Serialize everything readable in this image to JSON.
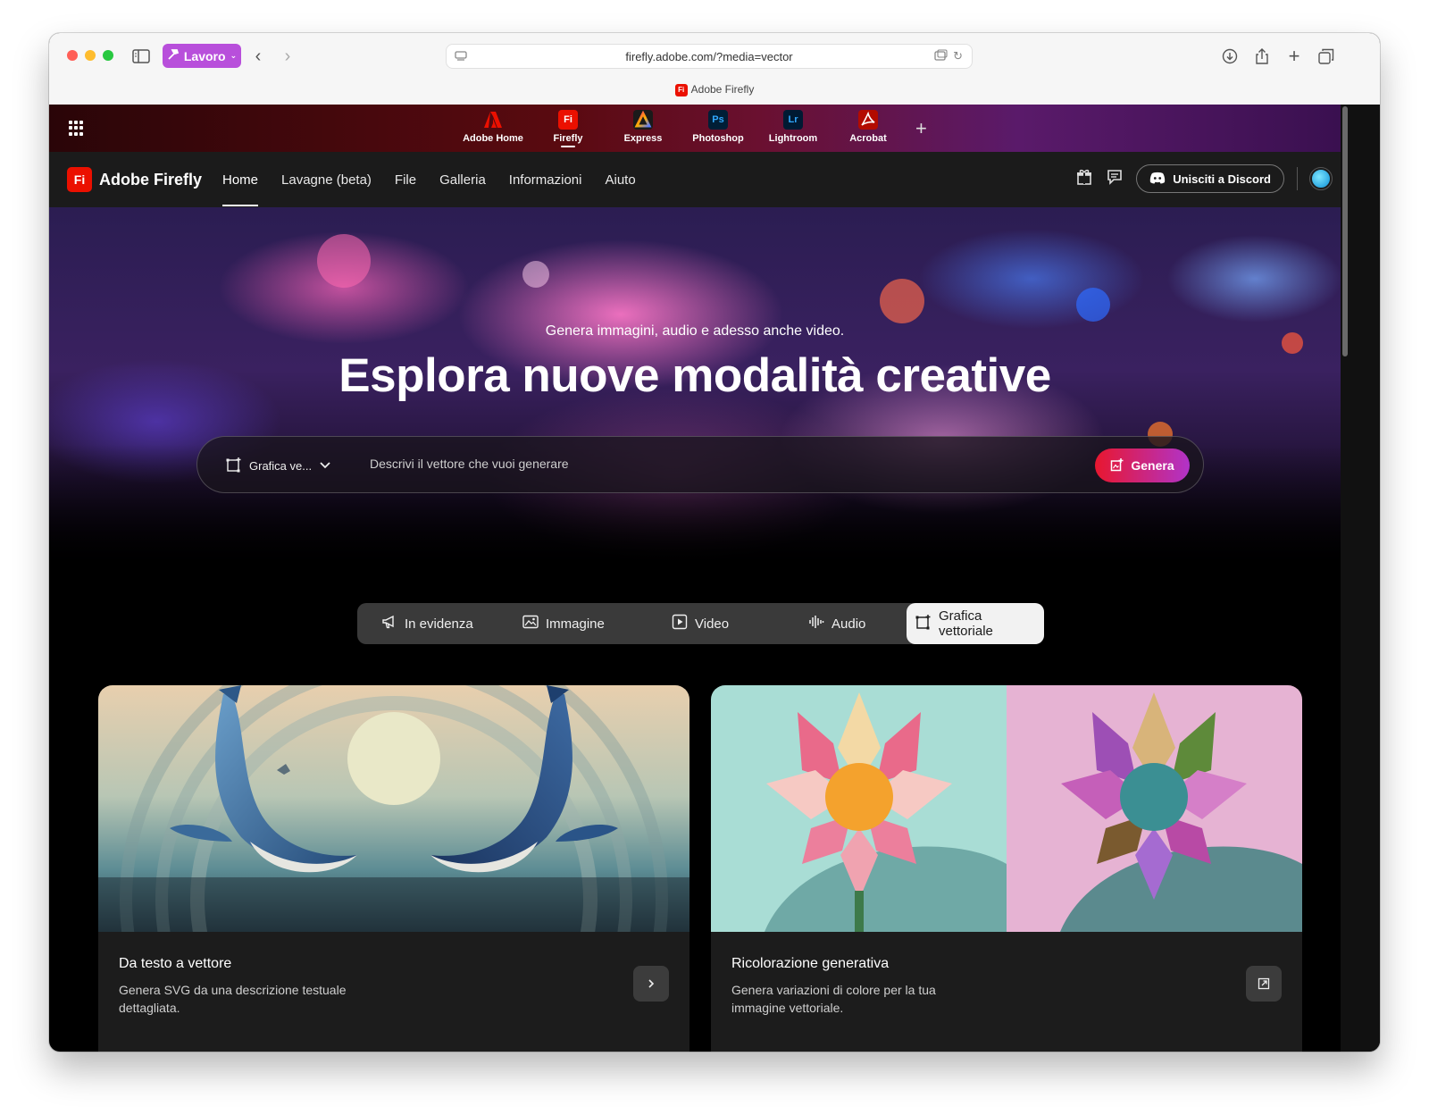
{
  "browser": {
    "profile_label": "Lavoro",
    "url": "firefly.adobe.com/?media=vector",
    "tab_title": "Adobe Firefly",
    "tab_favicon": "Fi"
  },
  "app_switcher": {
    "apps": [
      {
        "label": "Adobe Home",
        "icon_text": "",
        "color": "#eb1000"
      },
      {
        "label": "Firefly",
        "icon_text": "Fi",
        "color": "#eb1000"
      },
      {
        "label": "Express",
        "icon_text": "A",
        "color": "#1a1a1a"
      },
      {
        "label": "Photoshop",
        "icon_text": "Ps",
        "color": "#001e36"
      },
      {
        "label": "Lightroom",
        "icon_text": "Lr",
        "color": "#001a33"
      },
      {
        "label": "Acrobat",
        "icon_text": "",
        "color": "#b30b00"
      }
    ],
    "add_symbol": "+"
  },
  "navbar": {
    "logo_mark": "Fi",
    "logo_text": "Adobe Firefly",
    "links": [
      "Home",
      "Lavagne (beta)",
      "File",
      "Galleria",
      "Informazioni",
      "Aiuto"
    ],
    "discord_label": "Unisciti a Discord"
  },
  "hero": {
    "subtitle": "Genera immagini, audio e adesso anche video.",
    "title": "Esplora nuove modalità creative",
    "select_label": "Grafica ve...",
    "placeholder": "Descrivi il vettore che vuoi generare",
    "generate_label": "Genera"
  },
  "categories": [
    "In evidenza",
    "Immagine",
    "Video",
    "Audio",
    "Grafica vettoriale"
  ],
  "cards": [
    {
      "title": "Da testo a vettore",
      "description": "Genera SVG da una descrizione testuale dettagliata.",
      "button_icon": "chevron-right-icon"
    },
    {
      "title": "Ricolorazione generativa",
      "description": "Genera variazioni di colore per la tua immagine vettoriale.",
      "button_icon": "open-icon"
    }
  ],
  "colors": {
    "accent_red": "#eb1000",
    "genera_gradient_start": "#e8172f",
    "genera_gradient_end": "#b133c9",
    "profile_purple": "#b84fdb"
  }
}
